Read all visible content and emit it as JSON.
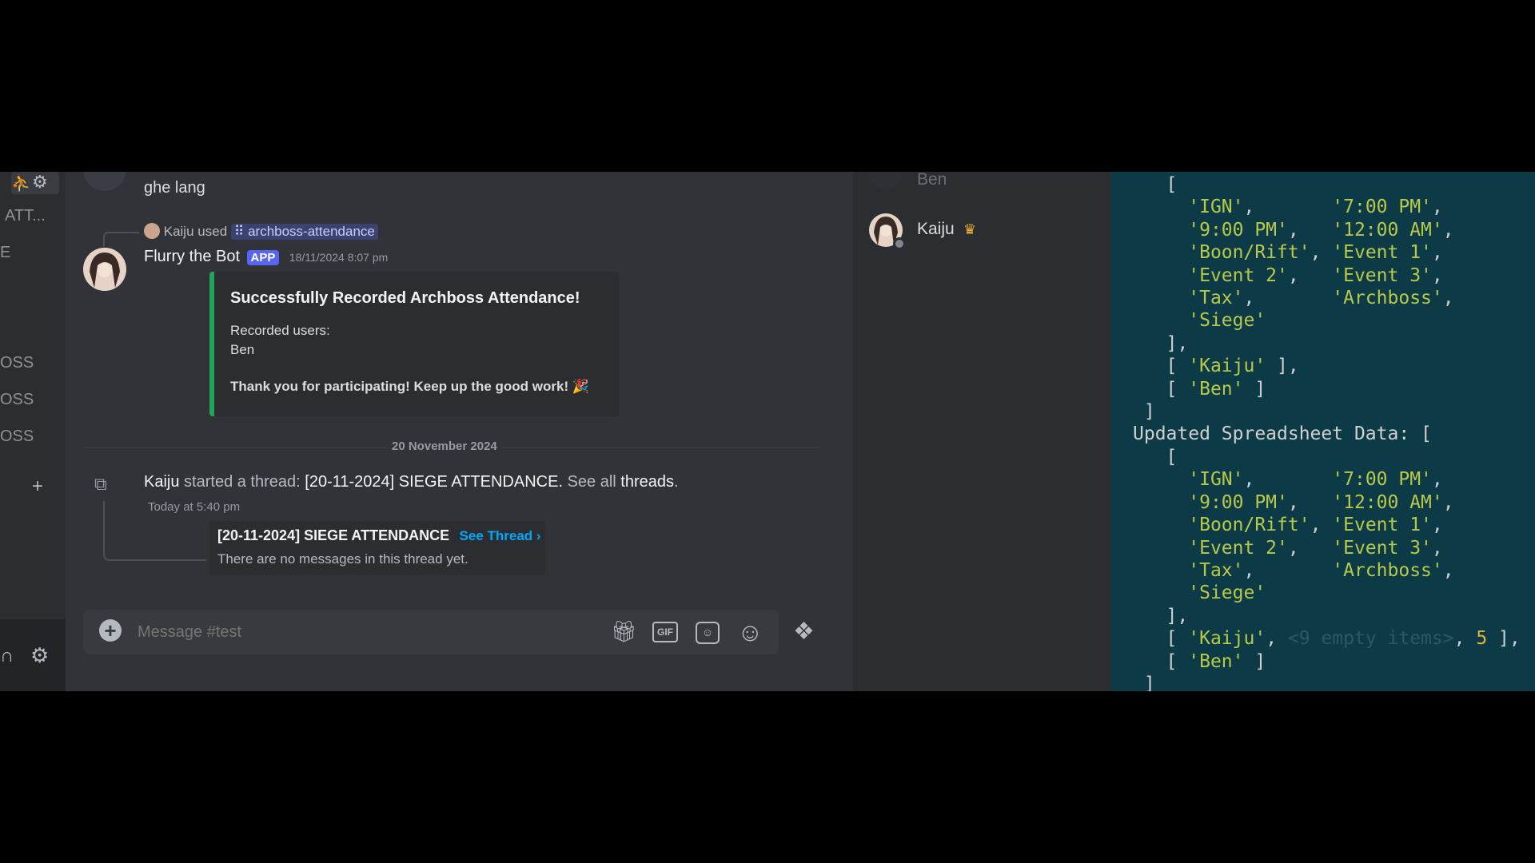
{
  "sidebar": {
    "items": [
      "ATT...",
      "E",
      "OSS",
      "OSS",
      "OSS"
    ],
    "add_label": "+"
  },
  "chat": {
    "prev_message": "ghe lang",
    "command_user": "Kaiju",
    "command_used_label": "used",
    "command_name": "archboss-attendance",
    "bot_name": "Flurry the Bot",
    "bot_badge": "APP",
    "bot_timestamp": "18/11/2024 8:07 pm",
    "embed": {
      "title": "Successfully Recorded Archboss Attendance!",
      "recorded_label": "Recorded users:",
      "recorded_user": "Ben",
      "thanks": "Thank you for participating! Keep up the good work! 🎉"
    },
    "date_divider": "20 November 2024",
    "thread_event": {
      "user": "Kaiju",
      "action": "started a thread:",
      "thread_name": "[20-11-2024] SIEGE ATTENDANCE",
      "see_all": "See all",
      "threads": "threads",
      "timestamp": "Today at 5:40 pm"
    },
    "thread_card": {
      "name": "[20-11-2024] SIEGE ATTENDANCE",
      "see_thread": "See Thread ›",
      "empty": "There are no messages in this thread yet."
    },
    "composer_placeholder": "Message #test"
  },
  "members": [
    {
      "name": "Ben",
      "status": "offline"
    },
    {
      "name": "Kaiju",
      "status": "online",
      "owner": true
    }
  ],
  "console": {
    "updated_label": "Updated Spreadsheet Data: [",
    "empty_items": "<9 empty items>",
    "number": "5"
  },
  "colors": {
    "accent": "#5865f2",
    "embed_bar": "#23a559",
    "link": "#00a8fc",
    "console_bg": "#0c3b47"
  }
}
